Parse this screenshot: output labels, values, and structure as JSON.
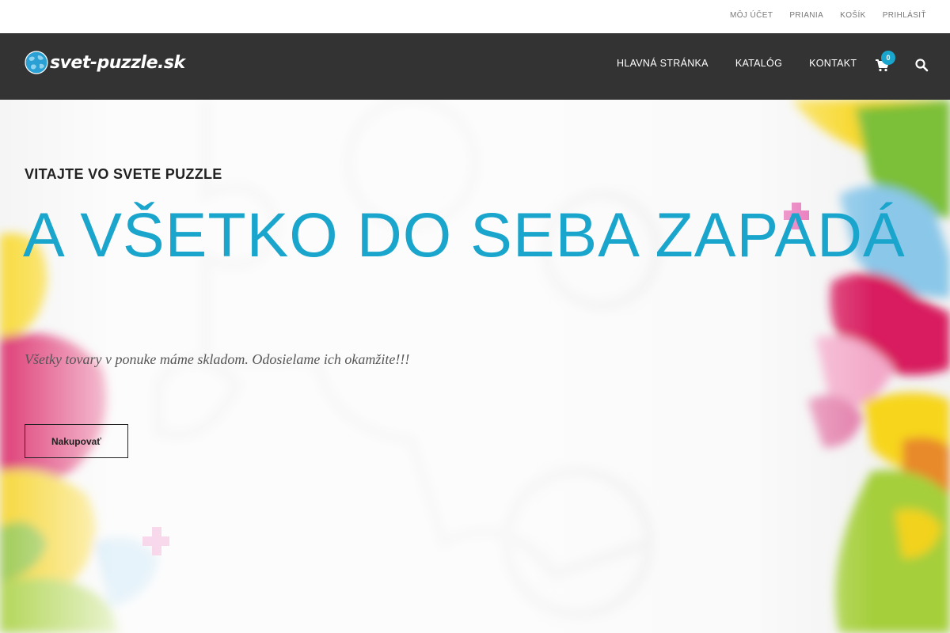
{
  "topbar": {
    "links": [
      {
        "label": "MÔJ ÚČET"
      },
      {
        "label": "PRIANIA"
      },
      {
        "label": "KOŠÍK"
      },
      {
        "label": "PRIHLÁSIŤ"
      }
    ]
  },
  "header": {
    "logo_text": "svet-puzzle.sk",
    "nav": [
      {
        "label": "HLAVNÁ STRÁNKA"
      },
      {
        "label": "KATALÓG"
      },
      {
        "label": "KONTAKT"
      }
    ],
    "cart_count": "0",
    "icons": {
      "cart": "shopping-cart-icon",
      "search": "search-icon",
      "logo": "globe-puzzle-icon"
    }
  },
  "hero": {
    "subtitle": "VITAJTE VO SVETE PUZZLE",
    "headline": "A VŠETKO DO SEBA ZAPADÁ",
    "tagline": "Všetky tovary v ponuke máme skladom. Odosielame ich okamžite!!!",
    "cta_label": "Nakupovať"
  },
  "colors": {
    "accent": "#1aa6cc",
    "header_bg": "#333333",
    "text_dark": "#222222"
  }
}
